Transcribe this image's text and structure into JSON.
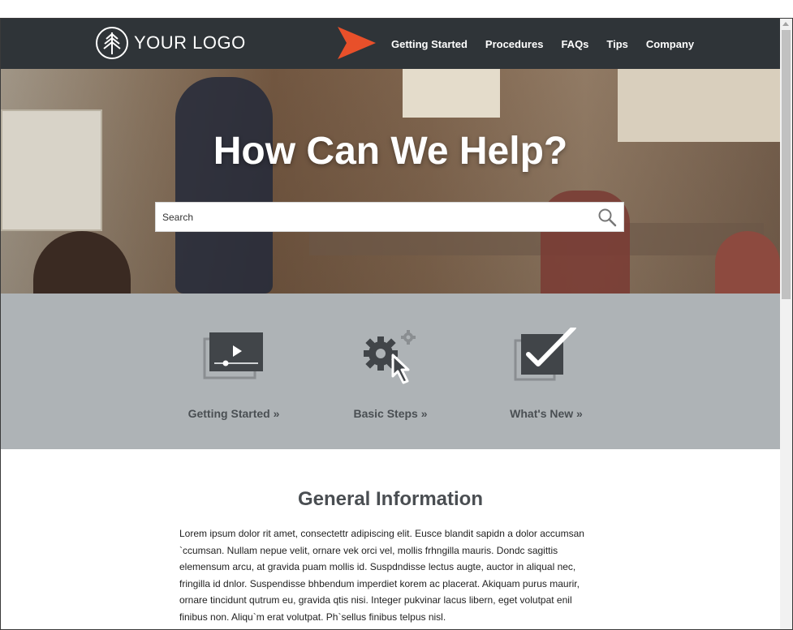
{
  "brand": {
    "logo_text": "YOUR LOGO"
  },
  "nav": {
    "items": [
      "Getting Started",
      "Procedures",
      "FAQs",
      "Tips",
      "Company"
    ]
  },
  "hero": {
    "title": "How Can We Help?",
    "search": {
      "placeholder": "Search"
    }
  },
  "tiles": [
    {
      "label": "Getting Started »",
      "icon": "video-player-icon"
    },
    {
      "label": "Basic Steps »",
      "icon": "gear-cursor-icon"
    },
    {
      "label": "What's New »",
      "icon": "checkmark-box-icon"
    }
  ],
  "info": {
    "title": "General Information",
    "body": "Lorem ipsum dolor rit amet, consectettr adipiscing elit. Eusce blandit sapidn a dolor accumsan `ccumsan. Nullam nepue velit, ornare vek orci vel, mollis frhngilla mauris. Dondc sagittis elemensum arcu, at gravida puam mollis id. Suspdndisse lectus augte, auctor in aliqual nec, fringilla id dnlor. Suspendisse bhbendum imperdiet korem ac placerat. Akiquam purus maurir, ornare tincidunt qutrum eu, gravida qtis nisi. Integer pukvinar lacus libern, eget volutpat enil finibus non. Aliqu`m erat volutpat. Ph`sellus finibus telpus nisl."
  },
  "colors": {
    "header_bg": "#2f3438",
    "accent_arrow": "#e8502a",
    "tiles_bg": "#aeb3b6",
    "icon_dark": "#414549"
  }
}
